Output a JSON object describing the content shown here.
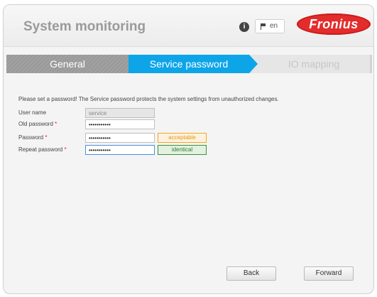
{
  "header": {
    "title": "System monitoring",
    "info_icon": "info-icon",
    "info_glyph": "i",
    "language": "en",
    "flag_icon": "flag-icon",
    "logo_text": "Fronius",
    "logo_color": "#e32c2c"
  },
  "steps": [
    {
      "label": "General",
      "state": "done"
    },
    {
      "label": "Service password",
      "state": "active",
      "color": "#0da5e8"
    },
    {
      "label": "IO mapping",
      "state": "pending"
    }
  ],
  "form": {
    "intro": "Please set a password! The Service password protects the system settings from unauthorized changes.",
    "required_marker": "*",
    "user_name": {
      "label": "User name",
      "value": "service"
    },
    "old_password": {
      "label": "Old password",
      "value": "•••••••••••"
    },
    "password": {
      "label": "Password",
      "value": "•••••••••••",
      "strength": "acceptable"
    },
    "repeat_password": {
      "label": "Repeat password",
      "value": "•••••••••••",
      "match": "identical"
    }
  },
  "buttons": {
    "back": "Back",
    "forward": "Forward"
  }
}
